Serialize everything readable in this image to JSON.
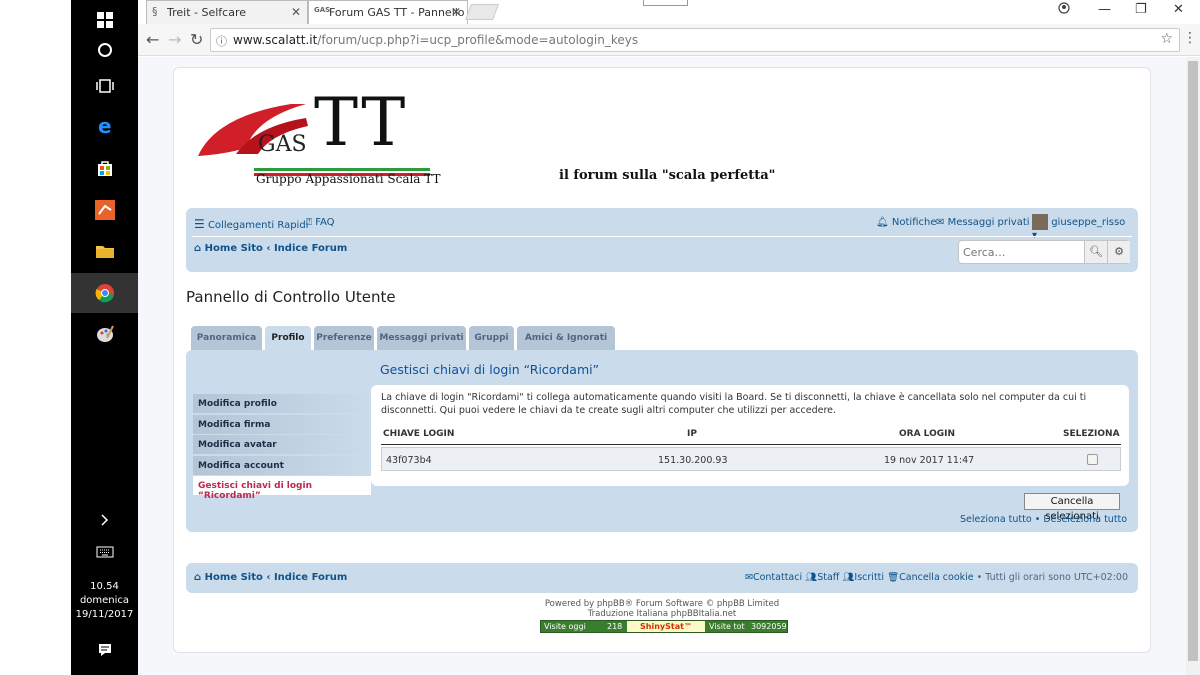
{
  "taskbar": {
    "time": "10.54",
    "day": "domenica",
    "date": "19/11/2017"
  },
  "browser": {
    "tabs": [
      {
        "label": "Treit - Selfcare"
      },
      {
        "label": "Forum GAS TT - Pannello"
      }
    ],
    "url_host": "www.scalatt.it",
    "url_path": "/forum/ucp.php?i=ucp_profile&mode=autologin_keys"
  },
  "logo": {
    "letters": "TT",
    "gas": "GAS",
    "tagline": "Gruppo Appassionati Scala TT"
  },
  "slogan": "il forum sulla \"scala perfetta\"",
  "navbar": {
    "quick_links": "Collegamenti Rapidi",
    "faq": "FAQ",
    "notifications": "Notifiche",
    "private_messages": "Messaggi privati",
    "username": "giuseppe_risso",
    "home_site": "Home Sito",
    "forum_index": "Indice Forum",
    "search_placeholder": "Cerca…"
  },
  "cp_title": "Pannello di Controllo Utente",
  "tabs": [
    "Panoramica",
    "Profilo",
    "Preferenze",
    "Messaggi privati",
    "Gruppi",
    "Amici & Ignorati"
  ],
  "sidebar": [
    "Modifica profilo",
    "Modifica firma",
    "Modifica avatar",
    "Modifica account",
    "Gestisci chiavi di login “Ricordami”"
  ],
  "content": {
    "title": "Gestisci chiavi di login “Ricordami”",
    "description": "La chiave di login \"Ricordami\" ti collega automaticamente quando visiti la Board. Se ti disconnetti, la chiave è cancellata solo nel computer da cui ti disconnetti. Qui puoi vedere le chiavi da te create sugli altri computer che utilizzi per accedere.",
    "columns": [
      "CHIAVE LOGIN",
      "IP",
      "ORA LOGIN",
      "SELEZIONA"
    ],
    "rows": [
      {
        "key": "43f073b4",
        "ip": "151.30.200.93",
        "time": "19 nov 2017 11:47"
      }
    ],
    "cancel_button": "Cancella selezionati",
    "select_all": "Seleziona tutto",
    "bullet": "•",
    "deselect_all": "Deseleziona tutto"
  },
  "footer": {
    "home_site": "Home Sito",
    "forum_index": "Indice Forum",
    "contact": "Contattaci",
    "staff": "Staff",
    "members": "Iscritti",
    "delete_cookies": "Cancella cookie",
    "timezone": "• Tutti gli orari sono UTC+02:00",
    "powered": "Powered by phpBB® Forum Software © phpBB Limited",
    "translation": "Traduzione Italiana phpBBItalia.net"
  },
  "counter": {
    "visits_today_label": "Visite oggi",
    "visits_today": "218",
    "brand": "ShinyStat™",
    "visits_total_label": "Visite tot",
    "visits_total": "3092059"
  }
}
